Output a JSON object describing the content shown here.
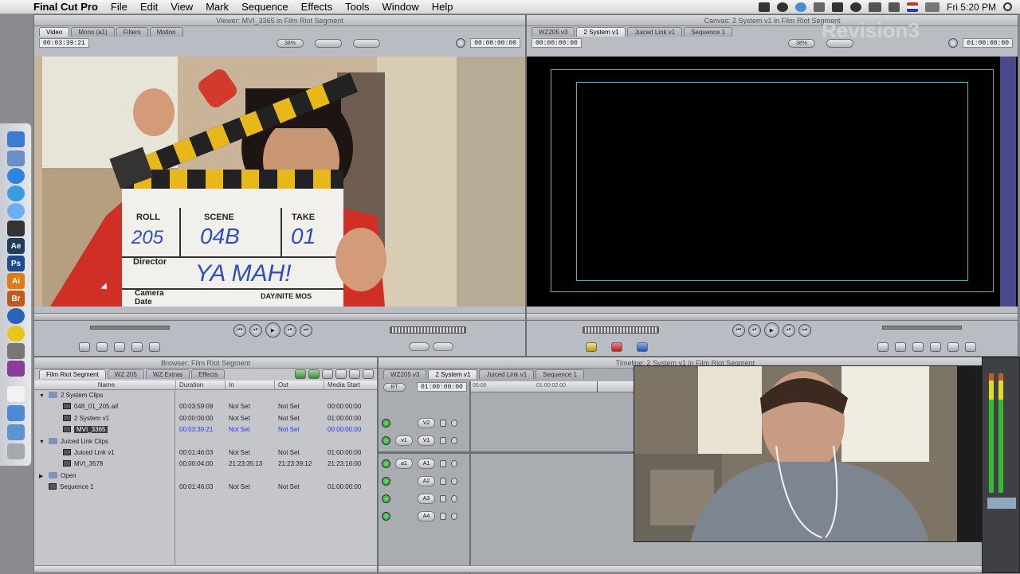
{
  "menubar": {
    "app": "Final Cut Pro",
    "items": [
      "File",
      "Edit",
      "View",
      "Mark",
      "Sequence",
      "Effects",
      "Tools",
      "Window",
      "Help"
    ],
    "clock": "Fri 5:20 PM"
  },
  "viewer": {
    "title": "Viewer: MVI_3365 in Film Riot Segment",
    "tabs": [
      "Video",
      "Mono (a1)",
      "Filters",
      "Motion"
    ],
    "timecode_duration": "00:03:39:21",
    "zoom": "38%",
    "timecode_current": "00:00:00:00",
    "slate": {
      "roll_label": "ROLL",
      "scene_label": "SCENE",
      "take_label": "TAKE",
      "roll": "205",
      "scene": "04B",
      "take": "01",
      "director_label": "Director",
      "director": "YA MAH!",
      "camera_label": "Camera",
      "date_label": "Date",
      "daynite": "DAY/NITE MOS"
    }
  },
  "canvas": {
    "title": "Canvas: 2 System v1 in Film Riot Segment",
    "tabs": [
      "WZ205 v3",
      "2 System v1",
      "Juiced Link v1",
      "Sequence 1"
    ],
    "timecode_duration": "00:00:00:00",
    "zoom": "38%",
    "timecode_current": "01:00:00:00",
    "watermark": "Revision3"
  },
  "browser": {
    "title": "Browser: Film Riot Segment",
    "tabs": [
      "Film Riot Segment",
      "WZ 205",
      "WZ Extras",
      "Effects"
    ],
    "columns": [
      "Name",
      "Duration",
      "In",
      "Out",
      "Media Start"
    ],
    "rows": [
      {
        "indent": 0,
        "type": "folder",
        "disclosure": "▼",
        "name": "2 System Clips",
        "duration": "",
        "in": "",
        "out": "",
        "media_start": ""
      },
      {
        "indent": 1,
        "type": "audio",
        "disclosure": "",
        "name": "048_01_205.aif",
        "duration": "00:03:59:09",
        "in": "Not Set",
        "out": "Not Set",
        "media_start": "00:00:00:00"
      },
      {
        "indent": 1,
        "type": "sequence",
        "disclosure": "",
        "name": "2 System v1",
        "duration": "00:00:00:00",
        "in": "Not Set",
        "out": "Not Set",
        "media_start": "01:00:00:00"
      },
      {
        "indent": 1,
        "type": "clip",
        "disclosure": "",
        "name": "MVI_3365",
        "duration": "00:03:39:21",
        "in": "Not Set",
        "out": "Not Set",
        "media_start": "00:00:00:00",
        "selected": true
      },
      {
        "indent": 0,
        "type": "folder",
        "disclosure": "▼",
        "name": "Juiced Link Clips",
        "duration": "",
        "in": "",
        "out": "",
        "media_start": ""
      },
      {
        "indent": 1,
        "type": "sequence",
        "disclosure": "",
        "name": "Juiced Link v1",
        "duration": "00:01:46:03",
        "in": "Not Set",
        "out": "Not Set",
        "media_start": "01:00:00:00"
      },
      {
        "indent": 1,
        "type": "clip",
        "disclosure": "",
        "name": "MVI_3578",
        "duration": "00:00:04:00",
        "in": "21:23:35:13",
        "out": "21:23:39:12",
        "media_start": "21:23:16:00"
      },
      {
        "indent": 0,
        "type": "folder",
        "disclosure": "▶",
        "name": "Open",
        "duration": "",
        "in": "",
        "out": "",
        "media_start": ""
      },
      {
        "indent": 0,
        "type": "sequence",
        "disclosure": "",
        "name": "Sequence 1",
        "duration": "00:01:46:03",
        "in": "Not Set",
        "out": "Not Set",
        "media_start": "01:00:00:00"
      }
    ]
  },
  "timeline": {
    "title": "Timeline: 2 System v1 in Film Riot Segment",
    "tabs": [
      "WZ205 v3",
      "2 System v1",
      "Juiced Link v1",
      "Sequence 1"
    ],
    "rt_label": "RT",
    "timecode": "01:00:00:00",
    "ruler": [
      "00:00",
      "01:00:02:00"
    ],
    "video_tracks": [
      {
        "src": "",
        "dest": "V2"
      },
      {
        "src": "v1",
        "dest": "V1"
      }
    ],
    "audio_tracks": [
      {
        "src": "a1",
        "dest": "A1"
      },
      {
        "src": "",
        "dest": "A2"
      },
      {
        "src": "",
        "dest": "A3"
      },
      {
        "src": "",
        "dest": "A4"
      }
    ]
  },
  "colors": {
    "accent_selected_text": "#2a35e6",
    "title_safe": "#3fb8c0",
    "canvas_bg": "#000000"
  }
}
